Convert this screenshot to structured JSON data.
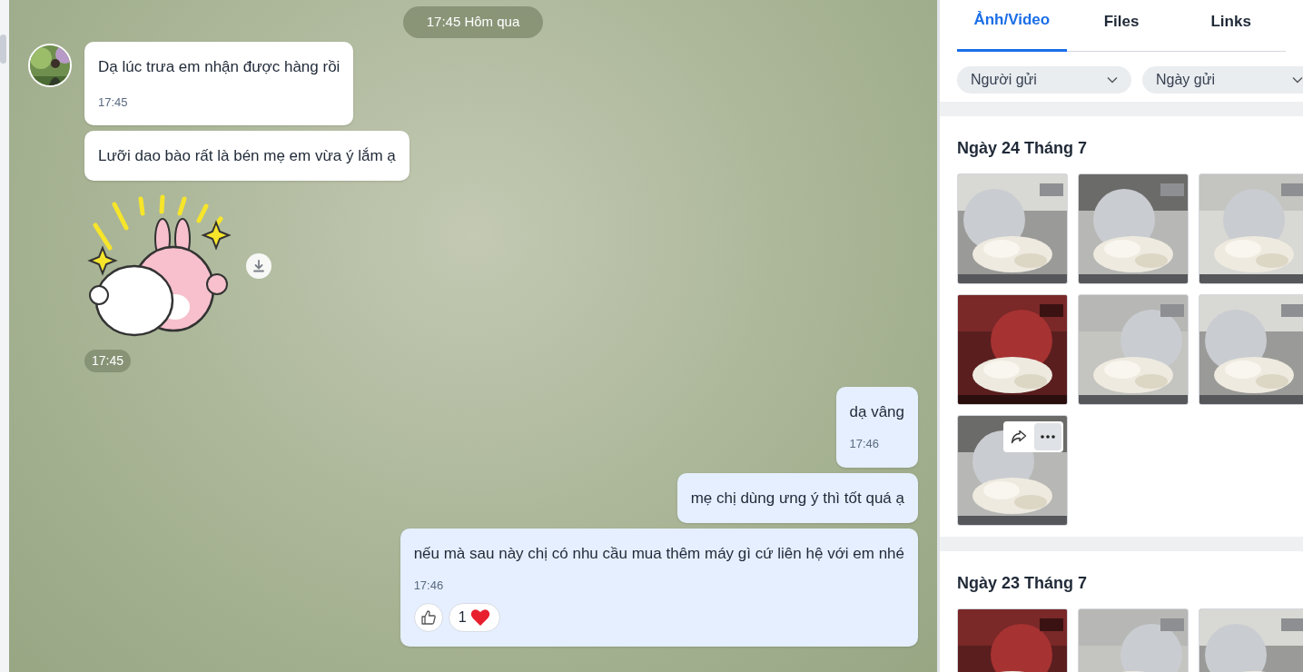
{
  "date_divider": "17:45 Hôm qua",
  "incoming": [
    {
      "text": "Dạ lúc trưa em nhận được hàng rồi",
      "time": "17:45"
    },
    {
      "text": "Lưỡi dao bào rất là bén mẹ em vừa ý lắm ạ"
    }
  ],
  "sticker": {
    "kind": "picture",
    "time": "17:45"
  },
  "outgoing": [
    {
      "text": "dạ vâng",
      "time": "17:46"
    },
    {
      "text": "mẹ chị dùng ưng ý thì tốt quá ạ"
    },
    {
      "text": "nếu mà sau này chị có nhu cầu mua thêm máy gì cứ liên hệ với em nhé",
      "time": "17:46",
      "reaction_count": "1"
    }
  ],
  "media_panel": {
    "tabs": [
      {
        "label": "Ảnh/Video",
        "selected": true
      },
      {
        "label": "Files",
        "selected": false
      },
      {
        "label": "Links",
        "selected": false
      }
    ],
    "filters": [
      {
        "label": "Người gửi"
      },
      {
        "label": "Ngày gửi"
      }
    ],
    "sections": [
      {
        "title": "Ngày 24 Tháng 7",
        "items": [
          {
            "kind": "picture",
            "hovered": false
          },
          {
            "kind": "picture",
            "hovered": false
          },
          {
            "kind": "picture",
            "hovered": false
          },
          {
            "kind": "picture",
            "hovered": false
          },
          {
            "kind": "picture",
            "hovered": false
          },
          {
            "kind": "picture",
            "hovered": false
          },
          {
            "kind": "picture",
            "hovered": true
          }
        ]
      },
      {
        "title": "Ngày 23 Tháng 7",
        "items": [
          {
            "kind": "picture",
            "hovered": false
          },
          {
            "kind": "picture",
            "hovered": false
          },
          {
            "kind": "picture",
            "hovered": false
          }
        ]
      }
    ]
  }
}
